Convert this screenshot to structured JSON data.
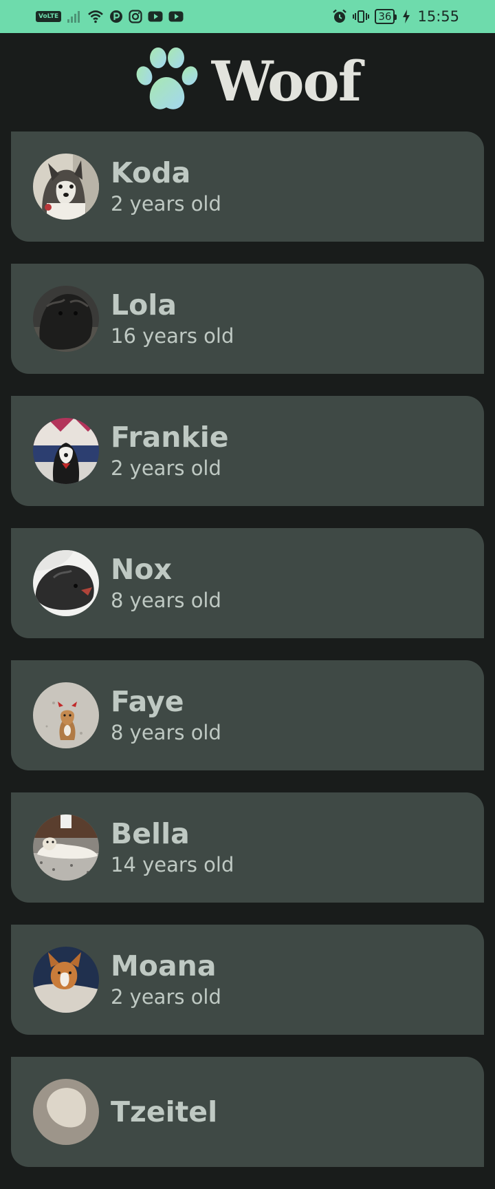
{
  "status_bar": {
    "network_badge": "VoLTE",
    "battery_level": "36",
    "time": "15:55",
    "icons": [
      "volte-icon",
      "signal-icon",
      "wifi-icon",
      "app-notification-icon",
      "instagram-icon",
      "youtube-icon",
      "youtube-icon",
      "alarm-icon",
      "vibrate-icon",
      "battery-icon",
      "charging-icon"
    ]
  },
  "header": {
    "title": "Woof",
    "logo_icon": "paw-icon"
  },
  "dogs": [
    {
      "name": "Koda",
      "age": "2 years old",
      "photo": "koda-photo"
    },
    {
      "name": "Lola",
      "age": "16 years old",
      "photo": "lola-photo"
    },
    {
      "name": "Frankie",
      "age": "2 years old",
      "photo": "frankie-photo"
    },
    {
      "name": "Nox",
      "age": "8 years old",
      "photo": "nox-photo"
    },
    {
      "name": "Faye",
      "age": "8 years old",
      "photo": "faye-photo"
    },
    {
      "name": "Bella",
      "age": "14 years old",
      "photo": "bella-photo"
    },
    {
      "name": "Moana",
      "age": "2 years old",
      "photo": "moana-photo"
    },
    {
      "name": "Tzeitel",
      "age": "",
      "photo": "tzeitel-photo"
    }
  ],
  "colors": {
    "status_bar_bg": "#6edbac",
    "background": "#191c1b",
    "card_bg": "#3f4945",
    "card_text": "#bfc9c3",
    "title_text": "#e2e3dd"
  }
}
